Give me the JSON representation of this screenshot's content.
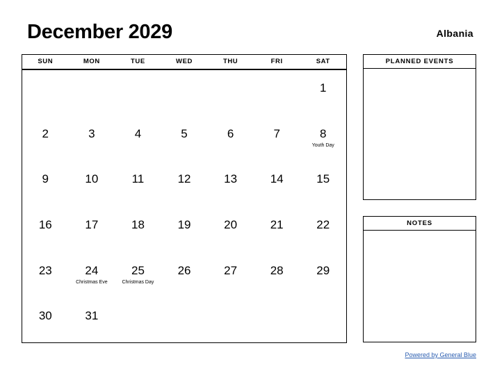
{
  "header": {
    "month_title": "December 2029",
    "country": "Albania"
  },
  "calendar": {
    "weekdays": [
      "SUN",
      "MON",
      "TUE",
      "WED",
      "THU",
      "FRI",
      "SAT"
    ],
    "weeks": [
      [
        {
          "day": "",
          "event": ""
        },
        {
          "day": "",
          "event": ""
        },
        {
          "day": "",
          "event": ""
        },
        {
          "day": "",
          "event": ""
        },
        {
          "day": "",
          "event": ""
        },
        {
          "day": "",
          "event": ""
        },
        {
          "day": "1",
          "event": ""
        }
      ],
      [
        {
          "day": "2",
          "event": ""
        },
        {
          "day": "3",
          "event": ""
        },
        {
          "day": "4",
          "event": ""
        },
        {
          "day": "5",
          "event": ""
        },
        {
          "day": "6",
          "event": ""
        },
        {
          "day": "7",
          "event": ""
        },
        {
          "day": "8",
          "event": "Youth Day"
        }
      ],
      [
        {
          "day": "9",
          "event": ""
        },
        {
          "day": "10",
          "event": ""
        },
        {
          "day": "11",
          "event": ""
        },
        {
          "day": "12",
          "event": ""
        },
        {
          "day": "13",
          "event": ""
        },
        {
          "day": "14",
          "event": ""
        },
        {
          "day": "15",
          "event": ""
        }
      ],
      [
        {
          "day": "16",
          "event": ""
        },
        {
          "day": "17",
          "event": ""
        },
        {
          "day": "18",
          "event": ""
        },
        {
          "day": "19",
          "event": ""
        },
        {
          "day": "20",
          "event": ""
        },
        {
          "day": "21",
          "event": ""
        },
        {
          "day": "22",
          "event": ""
        }
      ],
      [
        {
          "day": "23",
          "event": ""
        },
        {
          "day": "24",
          "event": "Christmas Eve"
        },
        {
          "day": "25",
          "event": "Christmas Day"
        },
        {
          "day": "26",
          "event": ""
        },
        {
          "day": "27",
          "event": ""
        },
        {
          "day": "28",
          "event": ""
        },
        {
          "day": "29",
          "event": ""
        }
      ],
      [
        {
          "day": "30",
          "event": ""
        },
        {
          "day": "31",
          "event": ""
        },
        {
          "day": "",
          "event": ""
        },
        {
          "day": "",
          "event": ""
        },
        {
          "day": "",
          "event": ""
        },
        {
          "day": "",
          "event": ""
        },
        {
          "day": "",
          "event": ""
        }
      ]
    ]
  },
  "panels": {
    "planned_events": {
      "title": "PLANNED EVENTS",
      "content": ""
    },
    "notes": {
      "title": "NOTES",
      "content": ""
    }
  },
  "footer": {
    "link_text": "Powered by General Blue",
    "link_color": "#2a5db0"
  }
}
